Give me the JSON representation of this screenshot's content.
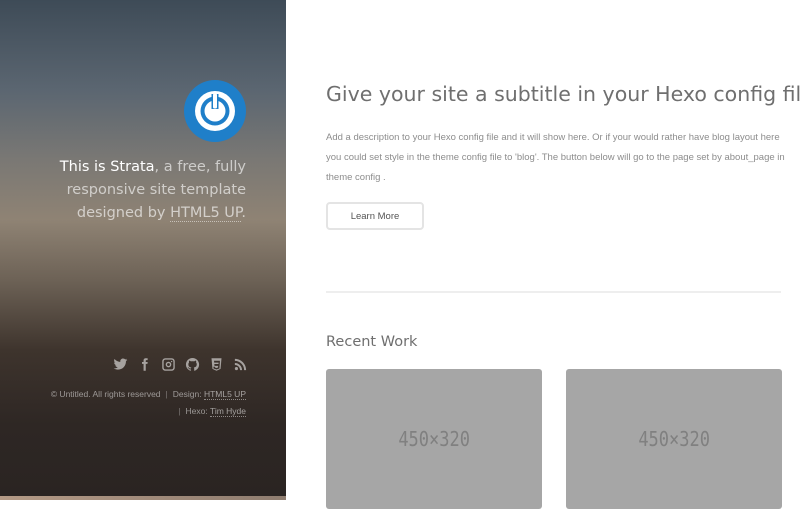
{
  "sidebar": {
    "avatar_icon": "power-icon",
    "avatar_color": "#1f7fc9",
    "intro": {
      "strong": "This is Strata",
      "text_before_link": ", a free, fully responsive site template designed by ",
      "link": "HTML5 UP",
      "text_after_link": "."
    },
    "social": [
      {
        "name": "twitter-icon",
        "label": "Twitter"
      },
      {
        "name": "facebook-icon",
        "label": "Facebook"
      },
      {
        "name": "instagram-icon",
        "label": "Instagram"
      },
      {
        "name": "github-icon",
        "label": "GitHub"
      },
      {
        "name": "html5-icon",
        "label": "HTML5"
      },
      {
        "name": "rss-icon",
        "label": "RSS"
      }
    ],
    "copyright": {
      "text": "© Untitled. All rights reserved",
      "separator": "|",
      "design_label": "Design: ",
      "design_link": "HTML5 UP",
      "hexo_label": "Hexo: ",
      "hexo_link": "Tim Hyde"
    }
  },
  "main": {
    "headline": "Give your site a subtitle in your Hexo config file.",
    "description": "Add a description to your Hexo config file and it will show here. Or if your would rather have blog layout here you could set style in the theme config file to 'blog'. The button below will go to the page set by about_page in theme config .",
    "button_label": "Learn More",
    "recent_work": {
      "title": "Recent Work",
      "items": [
        {
          "placeholder": "450×320"
        },
        {
          "placeholder": "450×320"
        }
      ]
    }
  }
}
